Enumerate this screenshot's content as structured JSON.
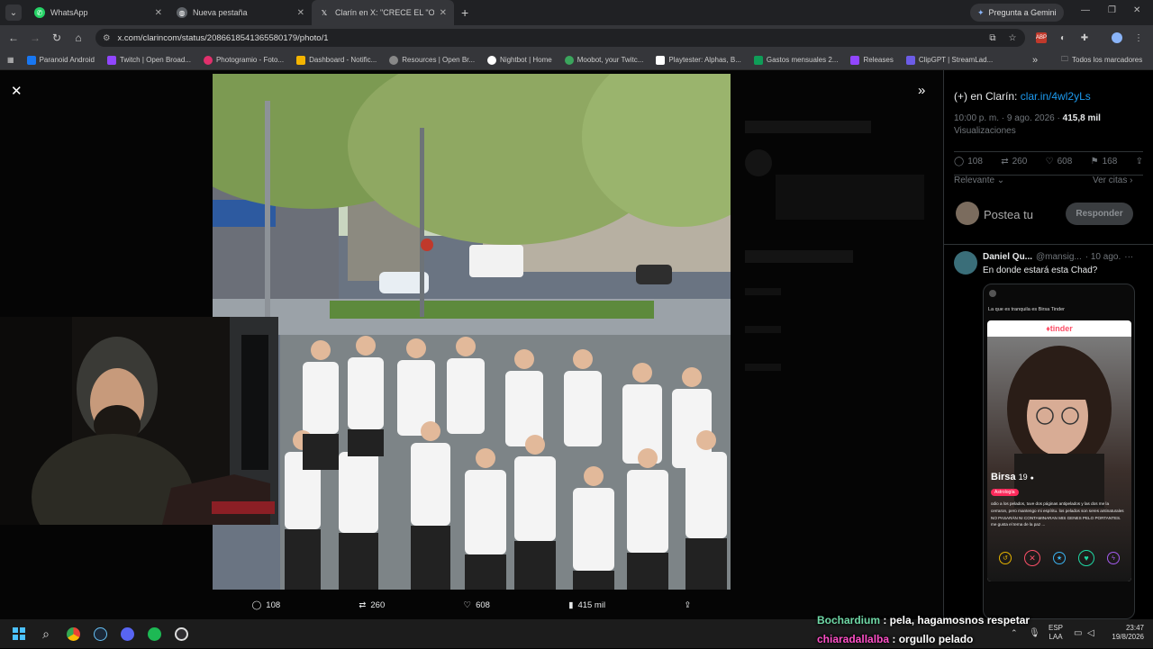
{
  "tabs": [
    {
      "title": "WhatsApp",
      "icon": "whatsapp-icon",
      "color": "#25d366"
    },
    {
      "title": "Nueva pestaña",
      "icon": "globe-icon",
      "color": "#5f6368"
    },
    {
      "title": "Clarín en X: \"CRECE EL \"ORGULLO\"",
      "icon": "x-icon",
      "color": "#000000"
    }
  ],
  "browser": {
    "gemini_label": "Pregunta a Gemini",
    "url": "x.com/clarincom/status/2086618541365580179/photo/1"
  },
  "bookmarks": [
    {
      "label": "Paranoid Android",
      "color": "#1877f2"
    },
    {
      "label": "Twitch | Open Broad...",
      "color": "#9146ff"
    },
    {
      "label": "Photogramio - Foto...",
      "color": "#e1306c"
    },
    {
      "label": "Dashboard - Notific...",
      "color": "#f4b400"
    },
    {
      "label": "Resources | Open Br...",
      "color": "#888888"
    },
    {
      "label": "Nightbot | Home",
      "color": "#ffffff"
    },
    {
      "label": "Moobot, your Twitc...",
      "color": "#3ba55d"
    },
    {
      "label": "Playtester: Alphas, B...",
      "color": "#ffffff"
    },
    {
      "label": "Gastos mensuales 2...",
      "color": "#0f9d58"
    },
    {
      "label": "Releases",
      "color": "#9146ff"
    },
    {
      "label": "ClipGPT | StreamLad...",
      "color": "#6c5ce7"
    }
  ],
  "bookmarks_more": "»",
  "bookmarks_all": "Todos los marcadores",
  "photo_bar": {
    "replies": "108",
    "reposts": "260",
    "likes": "608",
    "views": "415 mil"
  },
  "side": {
    "promo_text": "(+) en Clarín: ",
    "promo_link": "clar.in/4wl2yLs",
    "time": "10:00 p. m. · 9 ago. 2026 · ",
    "views": "415,8 mil",
    "views_label": "Visualizaciones",
    "replies": "108",
    "reposts": "260",
    "likes": "608",
    "bookmarks": "168",
    "sort_label": "Relevante",
    "quotes_label": "Ver citas",
    "compose_placeholder": "Postea tu",
    "reply_button": "Responder",
    "reply": {
      "name": "Daniel Qu...",
      "handle": "@mansig...",
      "date": "· 10 ago.",
      "text": "En donde estará esta Chad?"
    },
    "embedded": {
      "caption": "La que es tranquila es Birsa Tinder",
      "app": "tinder",
      "profile_name": "Birsa",
      "age": "19",
      "badge": "Astrología",
      "bio": "odio a los pelados, tuve dos páginas antipelados y las dos me la cerraron, pero mantengo mi espíritu. los pelados son seres antinaturales NO PASARÁN NI CONTAMINARAN MIS GENES PELO PORTANTES. me gusta el tema de la paz ..."
    }
  },
  "chat": [
    {
      "user": "Bochardium",
      "color": "#6fd8a6",
      "message": " : pela, hagamosnos respetar"
    },
    {
      "user": "chiaradallalba",
      "color": "#ff4fc8",
      "message": " : orgullo pelado"
    }
  ],
  "tray": {
    "lang1": "ESP",
    "lang2": "LAA",
    "time": "23:47",
    "date": "19/8/2026"
  }
}
